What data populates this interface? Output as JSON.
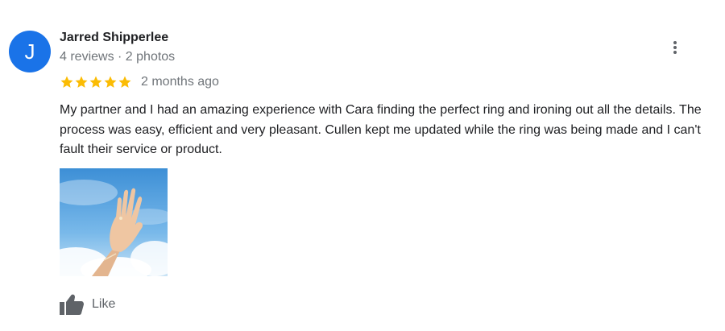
{
  "review": {
    "avatar_initial": "J",
    "reviewer_name": "Jarred Shipperlee",
    "reviewer_meta": "4 reviews · 2 photos",
    "rating": 5,
    "rating_max": 5,
    "date": "2 months ago",
    "text": "My partner and I had an amazing experience with Cara finding the perfect ring and ironing out all the details. The process was easy, efficient and very pleasant. Cullen kept me updated while the ring was being made and I can't fault their service or product.",
    "like_label": "Like"
  },
  "colors": {
    "avatar": "#1a73e8",
    "star": "#fbbc04",
    "meta_text": "#70757a",
    "icon": "#5f6368"
  },
  "icons": {
    "menu": "more-vert-icon",
    "like": "thumb-up-icon",
    "star": "star-icon"
  }
}
